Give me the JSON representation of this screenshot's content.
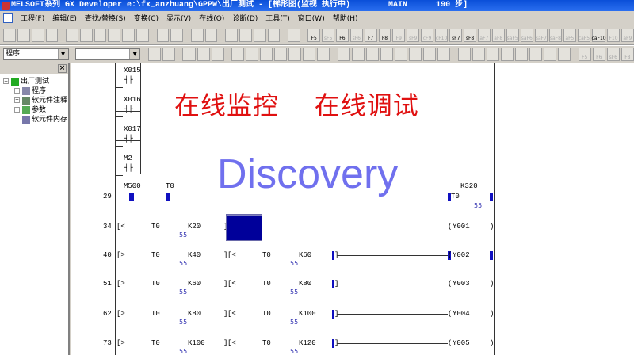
{
  "window": {
    "title": "MELSOFT系列 GX Developer e:\\fx_anzhuang\\GPPW\\出厂测试 - [梯形图(监视 执行中)        MAIN      190 步]"
  },
  "menu": [
    "工程(F)",
    "编辑(E)",
    "查找/替换(S)",
    "变换(C)",
    "显示(V)",
    "在线(O)",
    "诊断(D)",
    "工具(T)",
    "窗口(W)",
    "帮助(H)"
  ],
  "toolbar1_keys": [
    "F5",
    "sF5",
    "F6",
    "sF6",
    "F7",
    "F8",
    "F9",
    "sF9",
    "cF9",
    "cF10",
    "sF7",
    "sF8",
    "aF7",
    "aF8",
    "saF5",
    "saF6",
    "saF7",
    "saF8",
    "aF5",
    "caF5",
    "caF10",
    "F10",
    "aF9"
  ],
  "toolbar2": {
    "program_select": "程序",
    "second_select": "",
    "keys": [
      "F5",
      "F6",
      "sF6",
      "F8"
    ]
  },
  "tree": {
    "root": "出厂测试",
    "items": [
      "程序",
      "软元件注释",
      "参数",
      "软元件内存"
    ]
  },
  "watermark": {
    "cn": "在线监控    在线调试",
    "en": "Discovery"
  },
  "top_contacts": [
    "X015",
    "X016",
    "X017",
    "M2"
  ],
  "rungs": [
    {
      "step": "29",
      "type": "timer",
      "contacts": [
        "M500",
        "T0"
      ],
      "coil": "T0",
      "k": "K320",
      "value": "55"
    },
    {
      "step": "34",
      "compares": [
        {
          "op": "<",
          "dev": "T0",
          "k": "K20",
          "value": "55"
        }
      ],
      "coil": "Y001",
      "block": true
    },
    {
      "step": "40",
      "compares": [
        {
          "op": ">",
          "dev": "T0",
          "k": "K40",
          "value": "55"
        },
        {
          "op": "<",
          "dev": "T0",
          "k": "K60",
          "value": "55"
        }
      ],
      "coil": "Y002",
      "on": true
    },
    {
      "step": "51",
      "compares": [
        {
          "op": ">",
          "dev": "T0",
          "k": "K60",
          "value": "55"
        },
        {
          "op": "<",
          "dev": "T0",
          "k": "K80",
          "value": "55"
        }
      ],
      "coil": "Y003"
    },
    {
      "step": "62",
      "compares": [
        {
          "op": ">",
          "dev": "T0",
          "k": "K80",
          "value": "55"
        },
        {
          "op": "<",
          "dev": "T0",
          "k": "K100",
          "value": "55"
        }
      ],
      "coil": "Y004"
    },
    {
      "step": "73",
      "compares": [
        {
          "op": ">",
          "dev": "T0",
          "k": "K100",
          "value": "55"
        },
        {
          "op": "<",
          "dev": "T0",
          "k": "K120",
          "value": "55"
        }
      ],
      "coil": "Y005"
    }
  ]
}
